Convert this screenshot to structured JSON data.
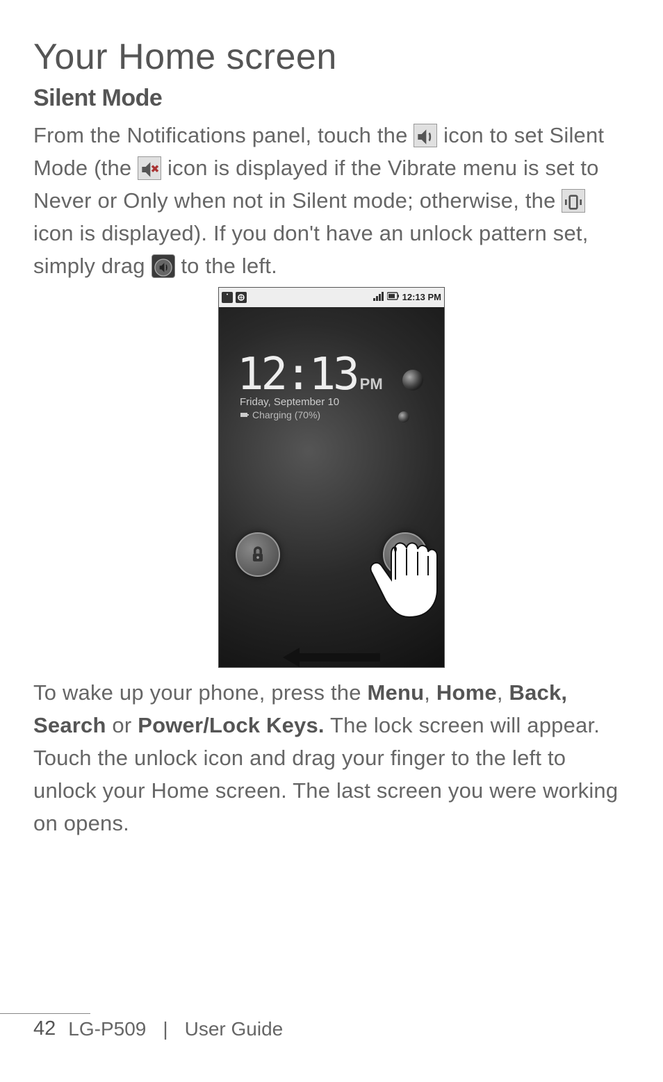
{
  "heading": "Your Home screen",
  "subheading": "Silent Mode",
  "para1a": "From the Notifications panel, touch the ",
  "para1b": " icon to set Silent Mode (the ",
  "para1c": " icon is displayed if the Vibrate menu is set to Never or Only when not in Silent mode; otherwise, the ",
  "para1d": " icon is displayed). If you don't have an unlock pattern set, simply drag ",
  "para1e": " to the left.",
  "statusbar": {
    "time": "12:13 PM"
  },
  "lockscreen": {
    "time": "12:13",
    "ampm": "PM",
    "date": "Friday, September 10",
    "charging": "Charging (70%)"
  },
  "para2a": "To wake up your phone, press the ",
  "para2_menu": "Menu",
  "para2_sep1": ", ",
  "para2_home": "Home",
  "para2_sep2": ", ",
  "para2_back": "Back, Search",
  "para2_or": " or ",
  "para2_power": "Power/Lock Keys.",
  "para2b": " The lock screen will appear. Touch the unlock icon and drag your finger to the left to unlock your Home screen. The last screen you were working on opens.",
  "footer": {
    "page": "42",
    "model": "LG-P509",
    "divider": "|",
    "guide": "User Guide"
  }
}
